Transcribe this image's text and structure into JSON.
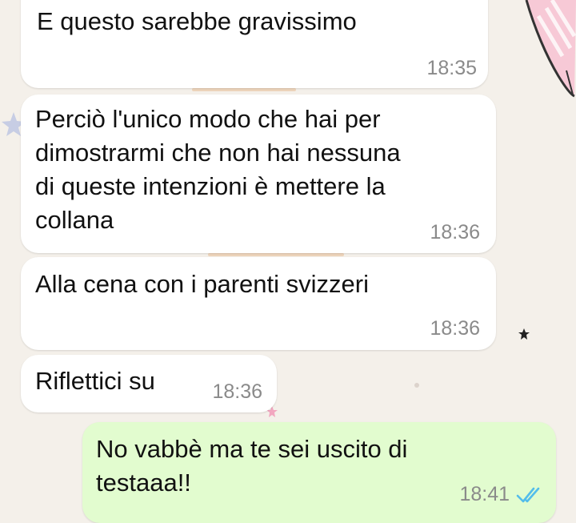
{
  "colors": {
    "wallpaper": "#f4f0ea",
    "incoming_bubble": "#ffffff",
    "outgoing_bubble": "#e2fccf",
    "text": "#111111",
    "timestamp": "#8a8a8a",
    "read_ticks": "#53bdeb"
  },
  "messages": [
    {
      "direction": "incoming",
      "text": "E questo sarebbe gravissimo",
      "time": "18:35"
    },
    {
      "direction": "incoming",
      "text": "Perciò l'unico modo che hai per\ndimostrarmi che non hai nessuna\ndi queste intenzioni è mettere la\ncollana",
      "time": "18:36"
    },
    {
      "direction": "incoming",
      "text": "Alla cena con i parenti svizzeri",
      "time": "18:36"
    },
    {
      "direction": "incoming",
      "text": "Riflettici su",
      "time": "18:36"
    },
    {
      "direction": "outgoing",
      "text": "No vabbè ma te sei uscito di\ntestaaa!!",
      "time": "18:41",
      "status_icon": "double-check-read-icon"
    }
  ]
}
